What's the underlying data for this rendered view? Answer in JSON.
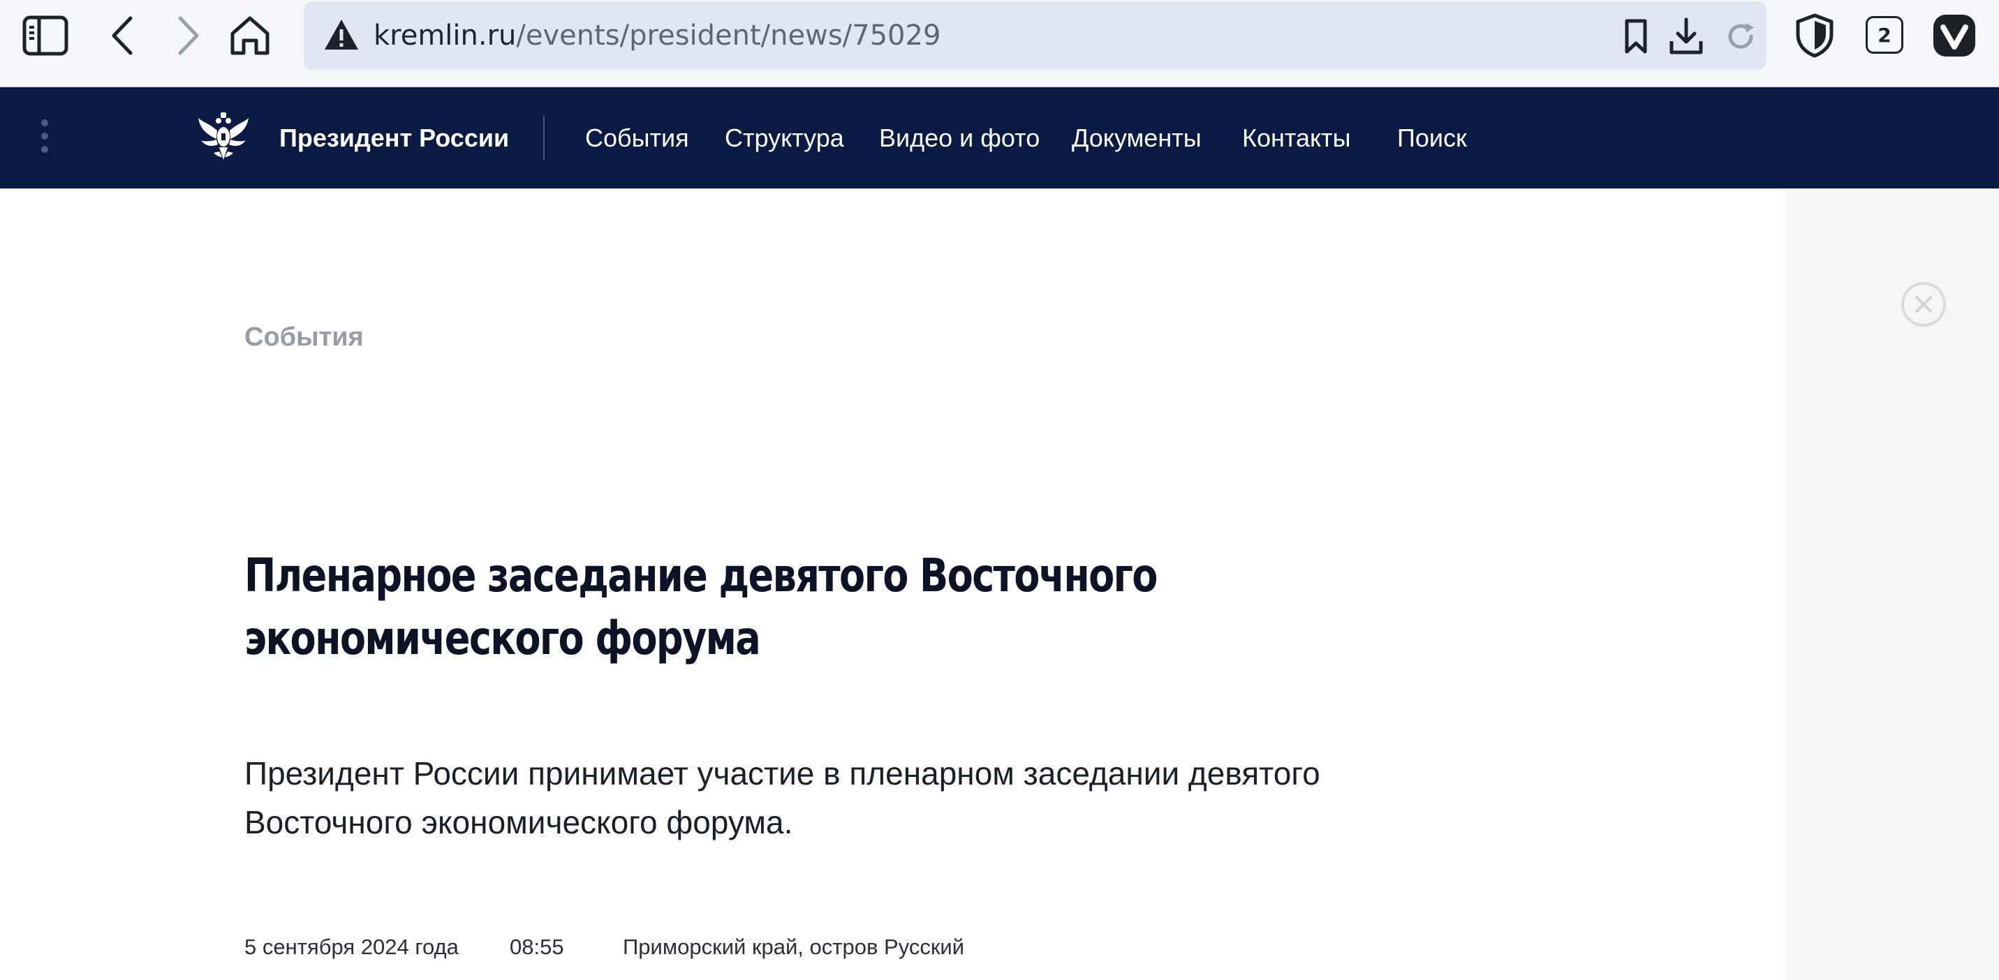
{
  "browser": {
    "url_host": "kremlin.ru",
    "url_path": "/events/president/news/75029",
    "tab_count": "2"
  },
  "nav": {
    "brand": "Президент России",
    "links": [
      "События",
      "Структура",
      "Видео и фото",
      "Документы",
      "Контакты",
      "Поиск"
    ]
  },
  "article": {
    "section": "События",
    "title_line1": "Пленарное заседание девятого Восточного",
    "title_line2": "экономического форума",
    "lead_line1": "Президент России принимает участие в пленарном заседании девятого",
    "lead_line2": "Восточного экономического форума.",
    "date": "5 сентября 2024 года",
    "time": "08:55",
    "place": "Приморский край, остров Русский"
  }
}
